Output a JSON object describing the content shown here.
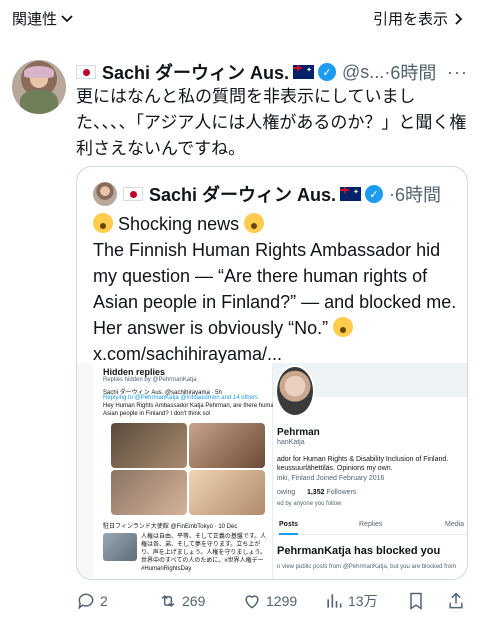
{
  "topbar": {
    "related_label": "関連性",
    "quote_label": "引用を表示"
  },
  "post": {
    "display_name": "Sachi ダーウィン Aus.",
    "handle": "@s...",
    "separator": "·",
    "time": "6時間",
    "text": "更にはなんと私の質問を非表示にしていました、、、、「アジア人には人権があるのか？」と聞く権利さえないんですね。"
  },
  "quoted": {
    "display_name": "Sachi ダーウィン Aus.",
    "separator": "·",
    "time": "6時間",
    "headline": "Shocking news",
    "text": "The Finnish Human Rights Ambassador hid my question — “Are there human rights of Asian people in Finland?” — and blocked me. Her answer is obviously “No.”",
    "link": "x.com/sachihirayama/..."
  },
  "screenshot": {
    "hidden_title": "Hidden replies",
    "hidden_sub": "Replies hidden by @PehrmanKatja",
    "inner_author": "Sachi ダーウィン Aus. @sachihirayama · 5h",
    "inner_reply": "Replying to @PehrmanKatja @Infoaustmon and 14 others",
    "inner_text1": "Hey Human Rights Ambassador Katja Pehrman, are there human rights of",
    "inner_text2": "Asian people in Finland? I don't think so!",
    "inner_embassy": "駐日フィンランド大使館 @FinEmbTokyo · 10 Dec",
    "inner_jp": "人権は自由、平等、そして正義の基盤です。人権は各、弟、そして夢を守ります。立ち上がり、声を上げましょう。人権を守りましょう。世界中のすべての人のために。#世界人権デー #HumanRightsDay",
    "profile_name": "Pehrman",
    "profile_handle": "hanKatja",
    "profile_bio": "ador for Human Rights & Disability Inclusion of Finland. keussuurlähettiläs. Opinions my own.",
    "profile_meta": "inki, Finland    Joined February 2016",
    "profile_following": "owing",
    "profile_followers_count": "1,352",
    "profile_followers_label": "Followers",
    "profile_by": "ed by anyone you follow",
    "tab_posts": "Posts",
    "tab_replies": "Replies",
    "tab_media": "Media",
    "blocked_title": "PehrmanKatja has blocked you",
    "blocked_small": "n view public posts from @PehrmanKatja, but you are blocked from"
  },
  "actions": {
    "replies": "2",
    "reposts": "269",
    "likes": "1299",
    "views": "13万"
  },
  "colors": {
    "text": "#0f1419",
    "muted": "#536471",
    "accent": "#1d9bf0",
    "border": "#cfd9de"
  }
}
